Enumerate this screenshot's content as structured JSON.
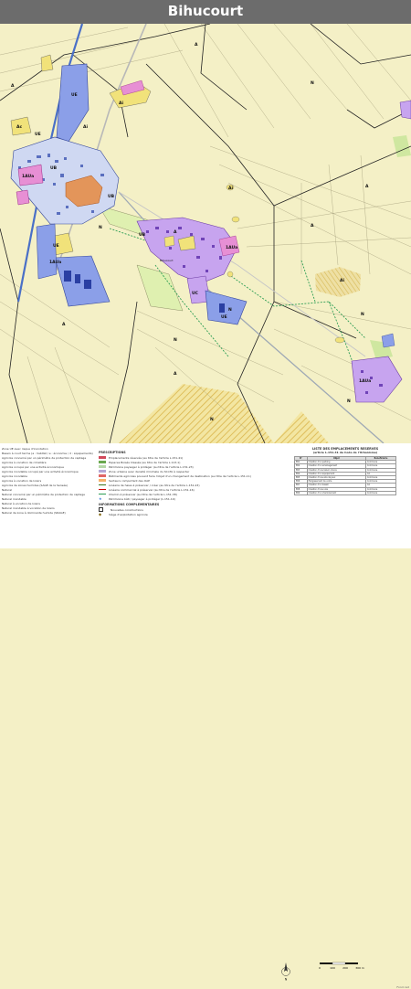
{
  "title": "Bihucourt",
  "colors": {
    "agri": "#f4f0c6",
    "urban_blue": "#8b9fe8",
    "urban_purple": "#c7a4ef",
    "old_center": "#e3955a",
    "activity": "#e78fd4",
    "garden": "#f4e88a",
    "natural": "#dff0b0",
    "hatched": "#e9c46a",
    "roads": "#ffffff",
    "paths": "#2e9e55",
    "boundaries": "#222222"
  },
  "zone_labels": [
    {
      "text": "A"
    },
    {
      "text": "A"
    },
    {
      "text": "N"
    },
    {
      "text": "UE"
    },
    {
      "text": "Ai"
    },
    {
      "text": "Ac"
    },
    {
      "text": "1AUa"
    },
    {
      "text": "UE"
    },
    {
      "text": "UB"
    },
    {
      "text": "UB"
    },
    {
      "text": "Ai"
    },
    {
      "text": "Ai"
    },
    {
      "text": "UB"
    },
    {
      "text": "UE"
    },
    {
      "text": "1AUa"
    },
    {
      "text": "1AUa"
    },
    {
      "text": "N"
    },
    {
      "text": "N"
    },
    {
      "text": "N"
    },
    {
      "text": "UC"
    },
    {
      "text": "UE"
    },
    {
      "text": "A"
    },
    {
      "text": "A"
    },
    {
      "text": "N"
    },
    {
      "text": "Ai"
    },
    {
      "text": "A"
    },
    {
      "text": "N"
    },
    {
      "text": "1AUa"
    },
    {
      "text": "A"
    },
    {
      "text": "A"
    },
    {
      "text": "N"
    },
    {
      "text": "Bihucourt"
    }
  ],
  "legend_left": [
    "Zone UE avec risque d'inondation",
    "Bassin à court terme (a : habitat / e : économie / d : équipements)",
    "",
    "Agricole concerné par un périmètre de protection de captage",
    "Agricole à vocation de cimetière",
    "Agricole occupé par une activité économique",
    "Agricole inondable occupé par une activité économique",
    "Agricole inondable",
    "Agricole à vocation de loisirs",
    "Agricole de zones humides (SAGE de la Sensée)",
    "Naturel",
    "Naturel concerné par un périmètre de protection de captage",
    "Naturel inondable",
    "Naturel à vocation de loisirs",
    "Naturel inondable à vocation de loisirs",
    "Naturel de zone à dominante humide (SDAGE)"
  ],
  "prescriptions": {
    "heading": "PRESCRIPTIONS",
    "items": [
      {
        "label": "Emplacements réservés (au titre de l'article L.151-41)",
        "color": "#d1495b"
      },
      {
        "label": "Espaces Boisés Classés (au titre de l'article L.113-1)",
        "color": "#6aa84f"
      },
      {
        "label": "Patrimoine paysager à protéger (au titre de l'article L.151-23)",
        "color": "#b6d7a8"
      },
      {
        "label": "Zone urbaine avec densité minimale du SCoTA à respecter",
        "color": "#b4a7d6"
      },
      {
        "label": "Bâtiments agricoles pouvant faire l'objet d'un changement de destination (au titre de l'article L.151-11)",
        "color": "#e06666"
      },
      {
        "label": "Secteurs comportant des OAP",
        "color": "#f6b26b"
      },
      {
        "label": "Linéaire de haies à préserver / créer (au titre de l'article L.151-23)",
        "color": "#38761d"
      },
      {
        "label": "Linéaire commercial à préserver (au titre de l'article L.151-16)",
        "color": "#cc0000"
      },
      {
        "label": "Chemin à préserver (au titre de l'article L.151-38)",
        "color": "#2e9e55"
      },
      {
        "label": "Patrimoine bâti / paysager à protéger (L.151-19)",
        "color": "#3c78d8"
      }
    ]
  },
  "informations": {
    "heading": "INFORMATIONS COMPLEMENTAIRES",
    "items": [
      {
        "label": "Nouvelles constructions"
      },
      {
        "label": "Siège d'exploitation agricole"
      }
    ]
  },
  "reserved_list": {
    "heading": "LISTE DES EMPLACEMENTS RESERVES",
    "subheading": "(article L.151-41 du Code de l'Urbanisme)",
    "columns": [
      "N°",
      "Objet",
      "Bénéficiaire"
    ],
    "rows": [
      [
        "ER1",
        "Création d'un parking",
        "Commune"
      ],
      [
        "ER2",
        "Création d'un aménagement",
        "Commune"
      ],
      [
        "ER3",
        "Création d'une liaison douce",
        "Commune"
      ],
      [
        "ER4",
        "Création d'un équipement",
        "CA"
      ],
      [
        "ER5",
        "Création d'une aire de jeux",
        "Commune"
      ],
      [
        "ER6",
        "Élargissement de voirie",
        "Commune"
      ],
      [
        "ER7",
        "Création d'un bassin",
        "CA"
      ],
      [
        "ER8",
        "Création d'une voie",
        "Commune"
      ],
      [
        "ER9",
        "Création d'un cheminement",
        "Commune"
      ]
    ]
  },
  "scale": {
    "ticks": [
      "0",
      "100",
      "200",
      "300 m"
    ]
  },
  "north_label": "N",
  "footer": "Fond cad"
}
